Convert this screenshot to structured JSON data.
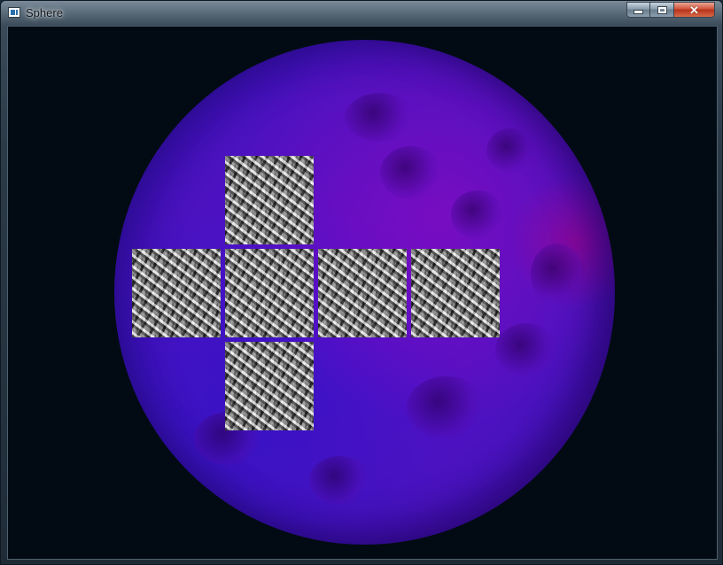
{
  "window": {
    "title": "Sphere",
    "controls": {
      "minimize": "minimize-icon",
      "maximize": "maximize-icon",
      "close": "close-icon"
    }
  },
  "scene": {
    "background_color": "#020b14",
    "sphere_colors": [
      "#5a0ec8",
      "#3a0fa8",
      "#aa0078"
    ],
    "texture_tiles": [
      {
        "face": "top"
      },
      {
        "face": "left"
      },
      {
        "face": "front"
      },
      {
        "face": "right"
      },
      {
        "face": "back"
      },
      {
        "face": "bottom"
      }
    ]
  }
}
